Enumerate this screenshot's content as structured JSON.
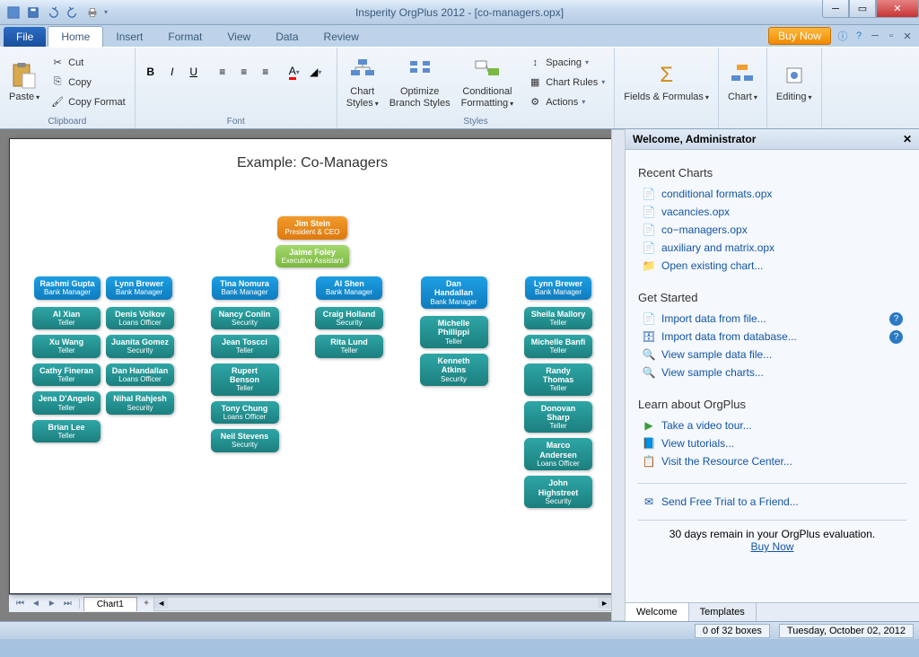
{
  "window": {
    "title": "Insperity OrgPlus 2012 - [co-managers.opx]"
  },
  "tabs": {
    "file": "File",
    "items": [
      "Home",
      "Insert",
      "Format",
      "View",
      "Data",
      "Review"
    ],
    "active": 0,
    "buy": "Buy Now"
  },
  "ribbon": {
    "clipboard": {
      "label": "Clipboard",
      "paste": "Paste",
      "cut": "Cut",
      "copy": "Copy",
      "copy_format": "Copy Format"
    },
    "font": {
      "label": "Font"
    },
    "styles": {
      "label": "Styles",
      "chart_styles": "Chart\nStyles",
      "optimize": "Optimize\nBranch Styles",
      "conditional": "Conditional\nFormatting",
      "spacing": "Spacing",
      "chart_rules": "Chart Rules",
      "actions": "Actions"
    },
    "fields": {
      "label": "Fields & Formulas"
    },
    "chart": {
      "label": "Chart"
    },
    "editing": {
      "label": "Editing"
    }
  },
  "canvas": {
    "title": "Example: Co-Managers",
    "sheet_tab": "Chart1"
  },
  "chart_data": {
    "type": "table",
    "tree": {
      "name": "Jim Stein",
      "title": "President & CEO",
      "assistant": {
        "name": "Jaime Foley",
        "title": "Executive Assistant"
      },
      "children": [
        {
          "name": "Rashmi Gupta",
          "title": "Bank Manager",
          "children": [
            {
              "name": "Al Xian",
              "title": "Teller"
            },
            {
              "name": "Xu Wang",
              "title": "Teller"
            },
            {
              "name": "Cathy Fineran",
              "title": "Teller"
            },
            {
              "name": "Jena D'Angelo",
              "title": "Teller"
            },
            {
              "name": "Brian Lee",
              "title": "Teller"
            }
          ]
        },
        {
          "name": "Lynn Brewer",
          "title": "Bank Manager",
          "children": [
            {
              "name": "Denis Volkov",
              "title": "Loans Officer"
            },
            {
              "name": "Juanita Gomez",
              "title": "Security"
            },
            {
              "name": "Dan Handallan",
              "title": "Loans Officer"
            },
            {
              "name": "Nihal Rahjesh",
              "title": "Security"
            }
          ]
        },
        {
          "name": "Tina Nomura",
          "title": "Bank Manager",
          "children": [
            {
              "name": "Nancy Conlin",
              "title": "Security"
            },
            {
              "name": "Jean Toscci",
              "title": "Teller"
            },
            {
              "name": "Rupert Benson",
              "title": "Teller"
            },
            {
              "name": "Tony Chung",
              "title": "Loans Officer"
            },
            {
              "name": "Neil Stevens",
              "title": "Security"
            }
          ]
        },
        {
          "name": "Al Shen",
          "title": "Bank Manager",
          "children": [
            {
              "name": "Craig Holland",
              "title": "Security"
            },
            {
              "name": "Rita Lund",
              "title": "Teller"
            }
          ]
        },
        {
          "name": "Dan Handallan",
          "title": "Bank Manager",
          "children": [
            {
              "name": "Michelle Phillippi",
              "title": "Teller"
            },
            {
              "name": "Kenneth Atkins",
              "title": "Security"
            }
          ]
        },
        {
          "name": "Lynn Brewer",
          "title": "Bank Manager",
          "children": [
            {
              "name": "Sheila Mallory",
              "title": "Teller"
            },
            {
              "name": "Michelle Banfi",
              "title": "Teller"
            },
            {
              "name": "Randy Thomas",
              "title": "Teller"
            },
            {
              "name": "Donovan Sharp",
              "title": "Teller"
            },
            {
              "name": "Marco Andersen",
              "title": "Loans Officer"
            },
            {
              "name": "John Highstreet",
              "title": "Security"
            }
          ]
        }
      ]
    }
  },
  "sidepanel": {
    "header": "Welcome, Administrator",
    "recent_title": "Recent Charts",
    "recent": [
      "conditional formats.opx",
      "vacancies.opx",
      "co−managers.opx",
      "auxiliary and matrix.opx"
    ],
    "open_existing": "Open existing chart...",
    "getstarted_title": "Get Started",
    "links_gs": [
      "Import data from file...",
      "Import data from database...",
      "View sample data file...",
      "View sample charts..."
    ],
    "learn_title": "Learn about OrgPlus",
    "links_learn": [
      "Take a video tour...",
      "View tutorials...",
      "Visit the Resource Center..."
    ],
    "send_trial": "Send Free Trial to a Friend...",
    "eval_text": "30 days remain in your OrgPlus evaluation.",
    "eval_buy": "Buy Now",
    "tab_welcome": "Welcome",
    "tab_templates": "Templates"
  },
  "status": {
    "boxes": "0 of 32 boxes",
    "date": "Tuesday, October 02, 2012"
  }
}
